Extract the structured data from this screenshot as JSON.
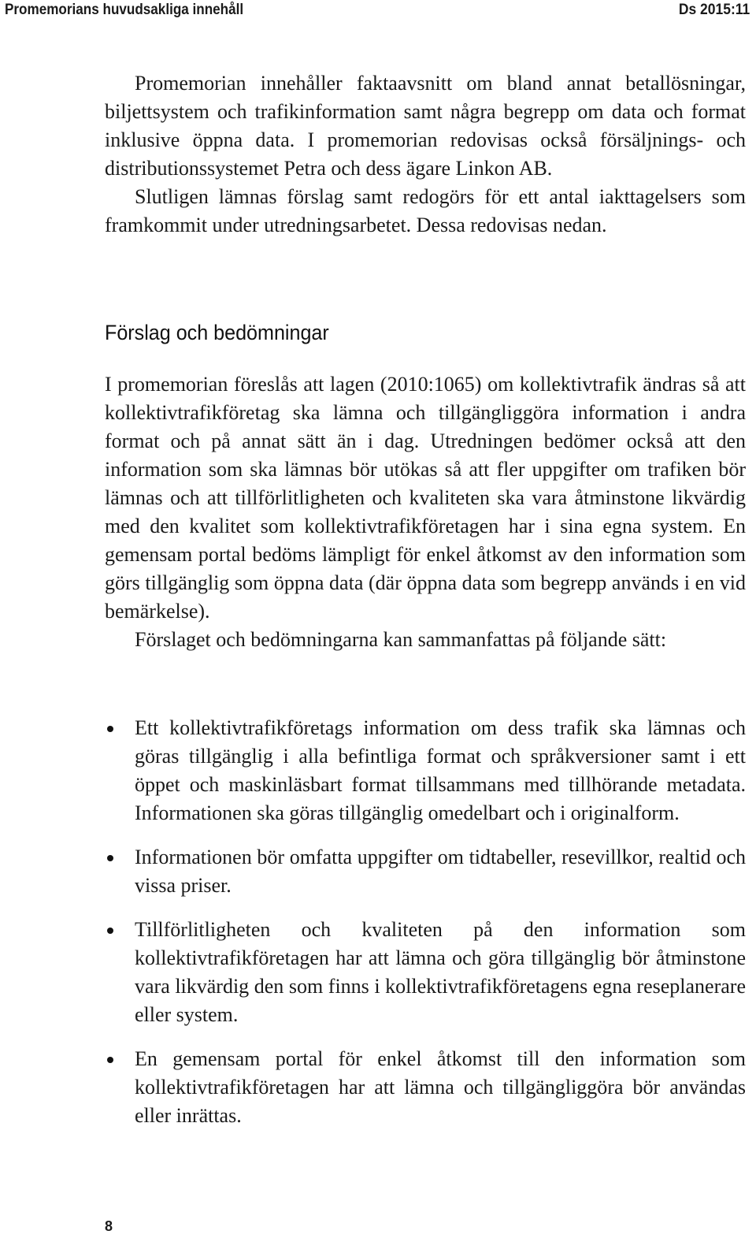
{
  "header": {
    "section_title": "Promemorians huvudsakliga innehåll",
    "document_id": "Ds 2015:11"
  },
  "intro": {
    "paragraphs": [
      "Promemorian innehåller faktaavsnitt om bland annat betal­lösningar, biljettsystem och trafikinformation samt några begrepp om data och format inklusive öppna data. I promemorian redovisas också försäljnings- och distributionssystemet Petra och dess ägare Linkon AB.",
      "Slutligen lämnas förslag samt redogörs för ett antal iakttagelsers som framkommit under utredningsarbetet. Dessa redovisas nedan."
    ]
  },
  "section": {
    "heading": "Förslag och bedömningar",
    "paragraphs": [
      "I promemorian föreslås att lagen (2010:1065) om kollektivtrafik ändras så att kollektivtrafikföretag ska lämna och tillgängliggöra information  i andra format och på annat sätt än i dag. Utredningen bedömer också att den information som ska lämnas bör utökas så att fler uppgifter om trafiken bör lämnas och att tillförlitligheten och kvaliteten ska vara åtminstone likvärdig med den kvalitet som kollektivtrafikföretagen har i sina egna system. En gemensam portal bedöms lämpligt för enkel åtkomst av den information som görs tillgänglig som öppna data (där öppna data som begrepp används i en vid bemärkelse).",
      "Förslaget och bedömningarna kan sammanfattas på följande sätt:"
    ],
    "bullets": [
      "Ett kollektivtrafikföretags information om dess trafik ska lämnas och göras tillgänglig i alla befintliga format och språkversioner samt i ett öppet och maskinläsbart format tillsammans med tillhörande metadata. Informationen ska göras tillgänglig omedelbart och i originalform.",
      "Informationen bör omfatta uppgifter om tidtabeller, resevillkor, realtid och vissa priser.",
      "Tillförlitligheten och kvaliteten på den information som kollektivtrafikföretagen har att lämna och göra tillgänglig bör åtminstone vara likvärdig den som finns i kollektivtrafikföretagens egna reseplanerare eller system.",
      "En gemensam portal för enkel åtkomst till den information som kollektivtrafikföretagen har att lämna och tillgängliggöra bör användas eller inrättas."
    ]
  },
  "footer": {
    "page_number": "8"
  }
}
